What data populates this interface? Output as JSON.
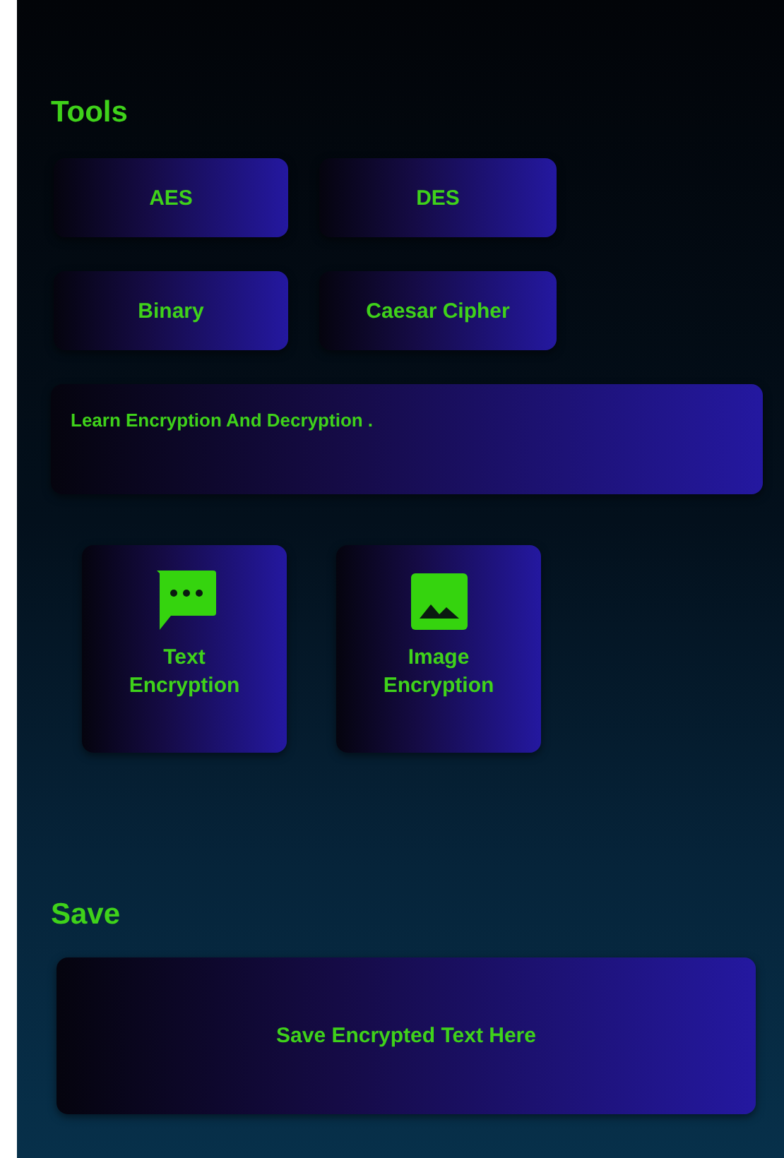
{
  "tools": {
    "title": "Tools",
    "buttons": [
      {
        "label": "AES"
      },
      {
        "label": "DES"
      },
      {
        "label": "Binary"
      },
      {
        "label": "Caesar Cipher"
      }
    ],
    "banner": "Learn Encryption And Decryption .",
    "tiles": [
      {
        "kind": "chat",
        "label": "Text\nEncryption"
      },
      {
        "kind": "image",
        "label": "Image\nEncryption"
      }
    ]
  },
  "save": {
    "title": "Save",
    "card": "Save Encrypted Text Here"
  }
}
